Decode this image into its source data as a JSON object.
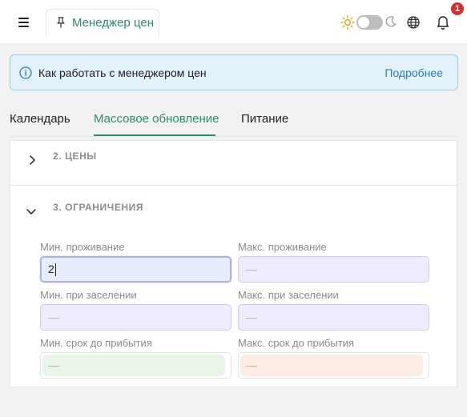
{
  "header": {
    "tab_title": "Менеджер цен",
    "notification_count": "1",
    "icons": [
      "menu-icon",
      "pin-icon",
      "sun-icon",
      "moon-icon",
      "globe-icon",
      "bell-icon"
    ],
    "theme_dark": false
  },
  "banner": {
    "text": "Как работать с менеджером цен",
    "link": "Подробнее"
  },
  "tabs": [
    {
      "label": "Календарь",
      "active": false
    },
    {
      "label": "Массовое обновление",
      "active": true
    },
    {
      "label": "Питание",
      "active": false
    }
  ],
  "sections": {
    "prices": {
      "title": "2. ЦЕНЫ",
      "expanded": false
    },
    "restrictions": {
      "title": "3. ОГРАНИЧЕНИЯ",
      "expanded": true
    }
  },
  "fields": {
    "min_stay": {
      "label": "Мин. проживание",
      "value": "2"
    },
    "max_stay": {
      "label": "Макс. проживание",
      "placeholder": "—"
    },
    "min_checkin": {
      "label": "Мин. при заселении",
      "placeholder": "—"
    },
    "max_checkin": {
      "label": "Макс. при заселении",
      "placeholder": "—"
    },
    "min_lead": {
      "label": "Мин. срок до прибытия",
      "placeholder": "—"
    },
    "max_lead": {
      "label": "Макс. срок до прибытия",
      "placeholder": "—"
    }
  },
  "colors": {
    "accent": "#2e8a6e",
    "link": "#2e7bbf",
    "badge": "#d22f2f",
    "banner_bg": "#e3f1fb"
  }
}
